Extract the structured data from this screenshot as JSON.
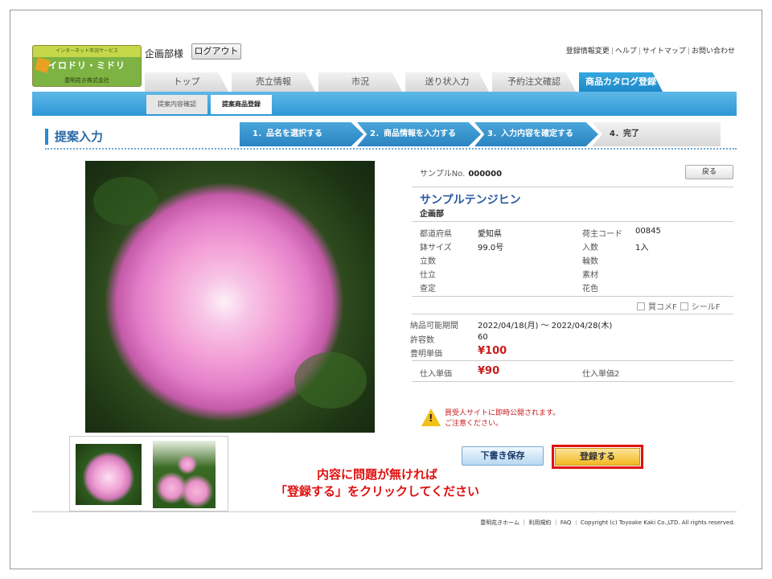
{
  "logo": {
    "tagline": "インターネット市況サービス",
    "name": "イロドリ・ミドリ",
    "company": "豊明花き株式会社"
  },
  "header": {
    "user": "企画部様",
    "logout": "ログアウト",
    "links": [
      "登録情報変更",
      "ヘルプ",
      "サイトマップ",
      "お問い合わせ"
    ]
  },
  "tabs": [
    "トップ",
    "売立情報",
    "市況",
    "送り状入力",
    "予約注文確認",
    "商品カタログ登録"
  ],
  "active_tab": 5,
  "subtabs": [
    "提案内容確認",
    "提案商品登録"
  ],
  "active_subtab": 1,
  "page_title": "提案入力",
  "steps": [
    "1．品名を選択する",
    "2．商品情報を入力する",
    "3．入力内容を確定する",
    "4．完了"
  ],
  "product": {
    "sample_label": "サンプルNo.",
    "sample_no": "000000",
    "back": "戻る",
    "name": "サンプルテンジヒン",
    "dept": "企画部",
    "left_fields": [
      {
        "label": "都道府県",
        "value": "愛知県"
      },
      {
        "label": "鉢サイズ",
        "value": "99.0号"
      },
      {
        "label": "立数",
        "value": ""
      },
      {
        "label": "仕立",
        "value": ""
      },
      {
        "label": "查定",
        "value": ""
      }
    ],
    "right_fields": [
      {
        "label": "荷主コード",
        "value": "00845"
      },
      {
        "label": "入数",
        "value": "1入"
      },
      {
        "label": "輪数",
        "value": ""
      },
      {
        "label": "素材",
        "value": ""
      },
      {
        "label": "花色",
        "value": ""
      }
    ],
    "check1": "買コメF",
    "check2": "シールF",
    "period_label": "納品可能期間",
    "period": "2022/04/18(月) ～ 2022/04/28(木)",
    "allow_label": "許容数",
    "allow": "60",
    "toyoake_label": "豊明単価",
    "toyoake_price": "¥100",
    "purchase_label": "仕入単価",
    "purchase_price": "¥90",
    "purchase2_label": "仕入単価2"
  },
  "warning": {
    "line1": "買受人サイトに即時公開されます。",
    "line2": "ご注意ください。"
  },
  "buttons": {
    "draft": "下書き保存",
    "register": "登録する"
  },
  "note": {
    "line1": "内容に問題が無ければ",
    "line2": "「登録する」をクリックしてください"
  },
  "footer": {
    "links": "豊明花きホーム ｜ 利用規約 ｜ FAQ ｜",
    "copyright": "Copyright (c) Toyoake Kaki Co.,LTD. All rights reserved."
  },
  "colors": {
    "accent": "#2d97d6",
    "price": "#c81c1c",
    "highlight": "#e01010"
  }
}
